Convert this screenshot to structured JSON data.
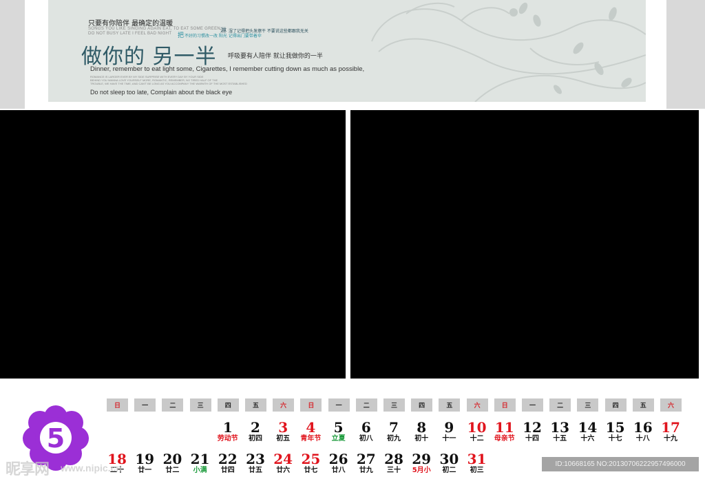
{
  "banner": {
    "tagline": "只要有你陪伴 最确定的温暖",
    "english_line1": "SONGS YOU LIKE SINGING AGAIN EAT, TO EAT SOME GREEN,",
    "english_line2": "DO NOT BUSY LATE I FEEL BAD NIGHT",
    "lin_mark": "淋",
    "lin_text": "湿了记得把头发擦干 不要说这些都跟我无关",
    "ba_mark": "把",
    "ba_text": "不好的习惯改一改 阳光 记得出门要带着伞",
    "big_title": "做你的 另一半",
    "title_sub": "呼吸要有人陪伴  就让我做你的一半",
    "english_dinner": "Dinner, remember to eat light some, Cigarettes, I remember cutting down as much as possible,",
    "fine_print1": "ROMANCE IS LARGER EVER BY MY SIDE SURPRISE WITH EVERY DAY BY YOUR SIDE",
    "fine_print2": "BEHIND YOU WANNA LOVE YOURSELF MORE, ROMANTIC, REMEMBER, NO TIRED HALF OF THE",
    "fine_print3": "TROUBLE, WE HAVE THE TIME, AND CAN'T BE LONG AS YOU ACCOMPANY THE WARMTH OF THE MOST ESTABLISHED",
    "english_sleep": "Do not sleep too late, Complain about the black eye"
  },
  "calendar": {
    "month": "5",
    "weekdays": [
      "日",
      "一",
      "二",
      "三",
      "四",
      "五",
      "六",
      "日",
      "一",
      "二",
      "三",
      "四",
      "五",
      "六",
      "日",
      "一",
      "二",
      "三",
      "四",
      "五",
      "六"
    ],
    "weekday_colors": [
      "red",
      "black",
      "black",
      "black",
      "black",
      "black",
      "red",
      "red",
      "black",
      "black",
      "black",
      "black",
      "black",
      "red",
      "red",
      "black",
      "black",
      "black",
      "black",
      "black",
      "red"
    ],
    "row1": [
      {
        "day": "1",
        "lunar": "劳动节",
        "day_red": false,
        "lunar_color": "red"
      },
      {
        "day": "2",
        "lunar": "初四",
        "day_red": false,
        "lunar_color": "black"
      },
      {
        "day": "3",
        "lunar": "初五",
        "day_red": true,
        "lunar_color": "black"
      },
      {
        "day": "4",
        "lunar": "青年节",
        "day_red": true,
        "lunar_color": "red"
      },
      {
        "day": "5",
        "lunar": "立夏",
        "day_red": false,
        "lunar_color": "green"
      },
      {
        "day": "6",
        "lunar": "初八",
        "day_red": false,
        "lunar_color": "black"
      },
      {
        "day": "7",
        "lunar": "初九",
        "day_red": false,
        "lunar_color": "black"
      },
      {
        "day": "8",
        "lunar": "初十",
        "day_red": false,
        "lunar_color": "black"
      },
      {
        "day": "9",
        "lunar": "十一",
        "day_red": false,
        "lunar_color": "black"
      },
      {
        "day": "10",
        "lunar": "十二",
        "day_red": true,
        "lunar_color": "black"
      },
      {
        "day": "11",
        "lunar": "母亲节",
        "day_red": true,
        "lunar_color": "red"
      },
      {
        "day": "12",
        "lunar": "十四",
        "day_red": false,
        "lunar_color": "black"
      },
      {
        "day": "13",
        "lunar": "十五",
        "day_red": false,
        "lunar_color": "black"
      },
      {
        "day": "14",
        "lunar": "十六",
        "day_red": false,
        "lunar_color": "black"
      },
      {
        "day": "15",
        "lunar": "十七",
        "day_red": false,
        "lunar_color": "black"
      },
      {
        "day": "16",
        "lunar": "十八",
        "day_red": false,
        "lunar_color": "black"
      },
      {
        "day": "17",
        "lunar": "十九",
        "day_red": true,
        "lunar_color": "black"
      }
    ],
    "row2": [
      {
        "day": "18",
        "lunar": "二十",
        "day_red": true,
        "lunar_color": "black"
      },
      {
        "day": "19",
        "lunar": "廿一",
        "day_red": false,
        "lunar_color": "black"
      },
      {
        "day": "20",
        "lunar": "廿二",
        "day_red": false,
        "lunar_color": "black"
      },
      {
        "day": "21",
        "lunar": "小满",
        "day_red": false,
        "lunar_color": "green"
      },
      {
        "day": "22",
        "lunar": "廿四",
        "day_red": false,
        "lunar_color": "black"
      },
      {
        "day": "23",
        "lunar": "廿五",
        "day_red": false,
        "lunar_color": "black"
      },
      {
        "day": "24",
        "lunar": "廿六",
        "day_red": true,
        "lunar_color": "black"
      },
      {
        "day": "25",
        "lunar": "廿七",
        "day_red": true,
        "lunar_color": "black"
      },
      {
        "day": "26",
        "lunar": "廿八",
        "day_red": false,
        "lunar_color": "black"
      },
      {
        "day": "27",
        "lunar": "廿九",
        "day_red": false,
        "lunar_color": "black"
      },
      {
        "day": "28",
        "lunar": "三十",
        "day_red": false,
        "lunar_color": "black"
      },
      {
        "day": "29",
        "lunar": "5月小",
        "day_red": false,
        "lunar_color": "red"
      },
      {
        "day": "30",
        "lunar": "初二",
        "day_red": false,
        "lunar_color": "black"
      },
      {
        "day": "31",
        "lunar": "初三",
        "day_red": true,
        "lunar_color": "black"
      }
    ]
  },
  "watermark": {
    "brand": "昵享网",
    "url": "www.nipic.cn",
    "id_text": "ID:10668165 NO:20130706222957496000"
  },
  "colors": {
    "holiday_red": "#e0141d",
    "solar_term_green": "#1a9a3a",
    "flower_purple": "#9b2fd6",
    "banner_bg": "#dfe4e1"
  }
}
